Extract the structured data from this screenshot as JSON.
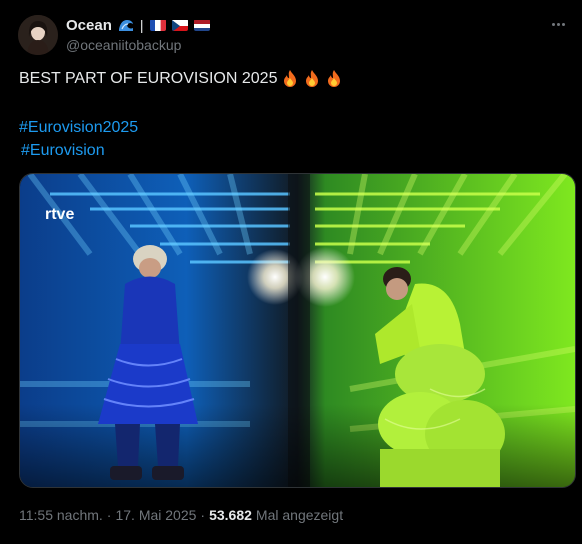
{
  "author": {
    "display_name": "Ocean",
    "handle": "@oceaniitobackup",
    "badge_icons": [
      "wave-icon",
      "flag-france-icon",
      "flag-czech-icon",
      "flag-netherlands-icon"
    ]
  },
  "tweet": {
    "text": "BEST PART OF EUROVISION 2025",
    "emoji": [
      "fire-icon",
      "fire-icon",
      "fire-icon"
    ],
    "hashtags": [
      "#Eurovision2025",
      "#Eurovision"
    ]
  },
  "media": {
    "watermark": "rtve"
  },
  "meta": {
    "time": "11:55 nachm.",
    "date": "17. Mai 2025",
    "views_count": "53.682",
    "views_label": "Mal angezeigt"
  },
  "colors": {
    "background": "#000000",
    "text": "#e7e9ea",
    "muted": "#71767b",
    "link": "#1d9bf0"
  }
}
